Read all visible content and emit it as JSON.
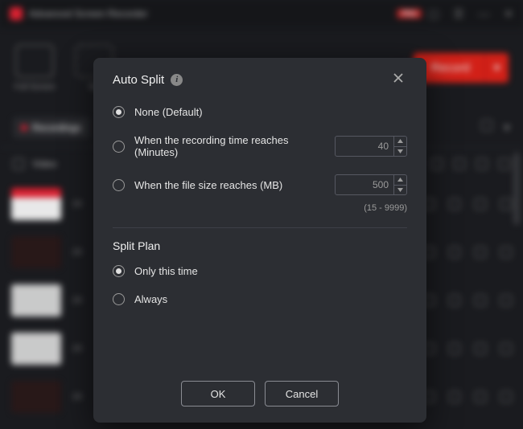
{
  "app": {
    "title": "Advanced Screen Recorder",
    "badge": "PRO",
    "record_button": "Record"
  },
  "tabs": {
    "recordings": "Recordings"
  },
  "list": {
    "video_header": "Video"
  },
  "modal": {
    "title": "Auto Split",
    "options": {
      "none": "None (Default)",
      "by_time": "When the recording time reaches (Minutes)",
      "by_size": "When the file size reaches (MB)",
      "time_value": "40",
      "size_value": "500",
      "size_hint": "(15 - 9999)"
    },
    "plan": {
      "title": "Split Plan",
      "once": "Only this time",
      "always": "Always"
    },
    "buttons": {
      "ok": "OK",
      "cancel": "Cancel"
    }
  },
  "bg_rows_date": "20"
}
